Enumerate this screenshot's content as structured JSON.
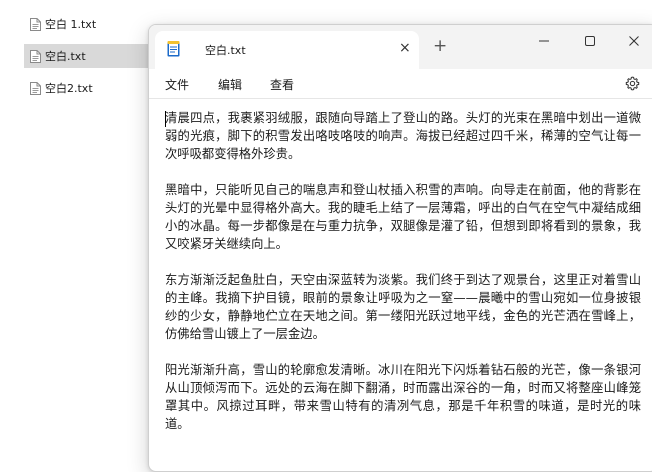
{
  "files": [
    {
      "name": "空白 1.txt",
      "selected": false
    },
    {
      "name": "空白.txt",
      "selected": true
    },
    {
      "name": "空白2.txt",
      "selected": false
    }
  ],
  "notepad": {
    "tab_title": "空白.txt",
    "tab_close_glyph": "×",
    "new_tab_glyph": "+",
    "menu": {
      "file": "文件",
      "edit": "编辑",
      "view": "查看"
    },
    "paragraphs": [
      "清晨四点，我裹紧羽绒服，跟随向导踏上了登山的路。头灯的光束在黑暗中划出一道微弱的光痕，脚下的积雪发出咯吱咯吱的响声。海拔已经超过四千米，稀薄的空气让每一次呼吸都变得格外珍贵。",
      "黑暗中，只能听见自己的喘息声和登山杖插入积雪的声响。向导走在前面，他的背影在头灯的光晕中显得格外高大。我的睫毛上结了一层薄霜，呼出的白气在空气中凝结成细小的冰晶。每一步都像是在与重力抗争，双腿像是灌了铅，但想到即将看到的景象，我又咬紧牙关继续向上。",
      "东方渐渐泛起鱼肚白，天空由深蓝转为淡紫。我们终于到达了观景台，这里正对着雪山的主峰。我摘下护目镜，眼前的景象让呼吸为之一窒——晨曦中的雪山宛如一位身披银纱的少女，静静地伫立在天地之间。第一缕阳光跃过地平线，金色的光芒洒在雪峰上，仿佛给雪山镀上了一层金边。",
      "阳光渐渐升高，雪山的轮廓愈发清晰。冰川在阳光下闪烁着钻石般的光芒，像一条银河从山顶倾泻而下。远处的云海在脚下翻涌，时而露出深谷的一角，时而又将整座山峰笼罩其中。风掠过耳畔，带来雪山特有的清冽气息，那是千年积雪的味道，是时光的味道。"
    ]
  },
  "colors": {
    "titlebar": "#f3f3f3",
    "selected_file": "#d9d9d9",
    "app_icon_blue": "#1b6ac9",
    "app_icon_yellow": "#f2c12e"
  },
  "icons": {
    "file": "file-icon",
    "app": "notepad-app-icon",
    "minimize": "minimize-icon",
    "maximize": "maximize-icon",
    "close": "close-icon",
    "settings": "gear-icon"
  }
}
